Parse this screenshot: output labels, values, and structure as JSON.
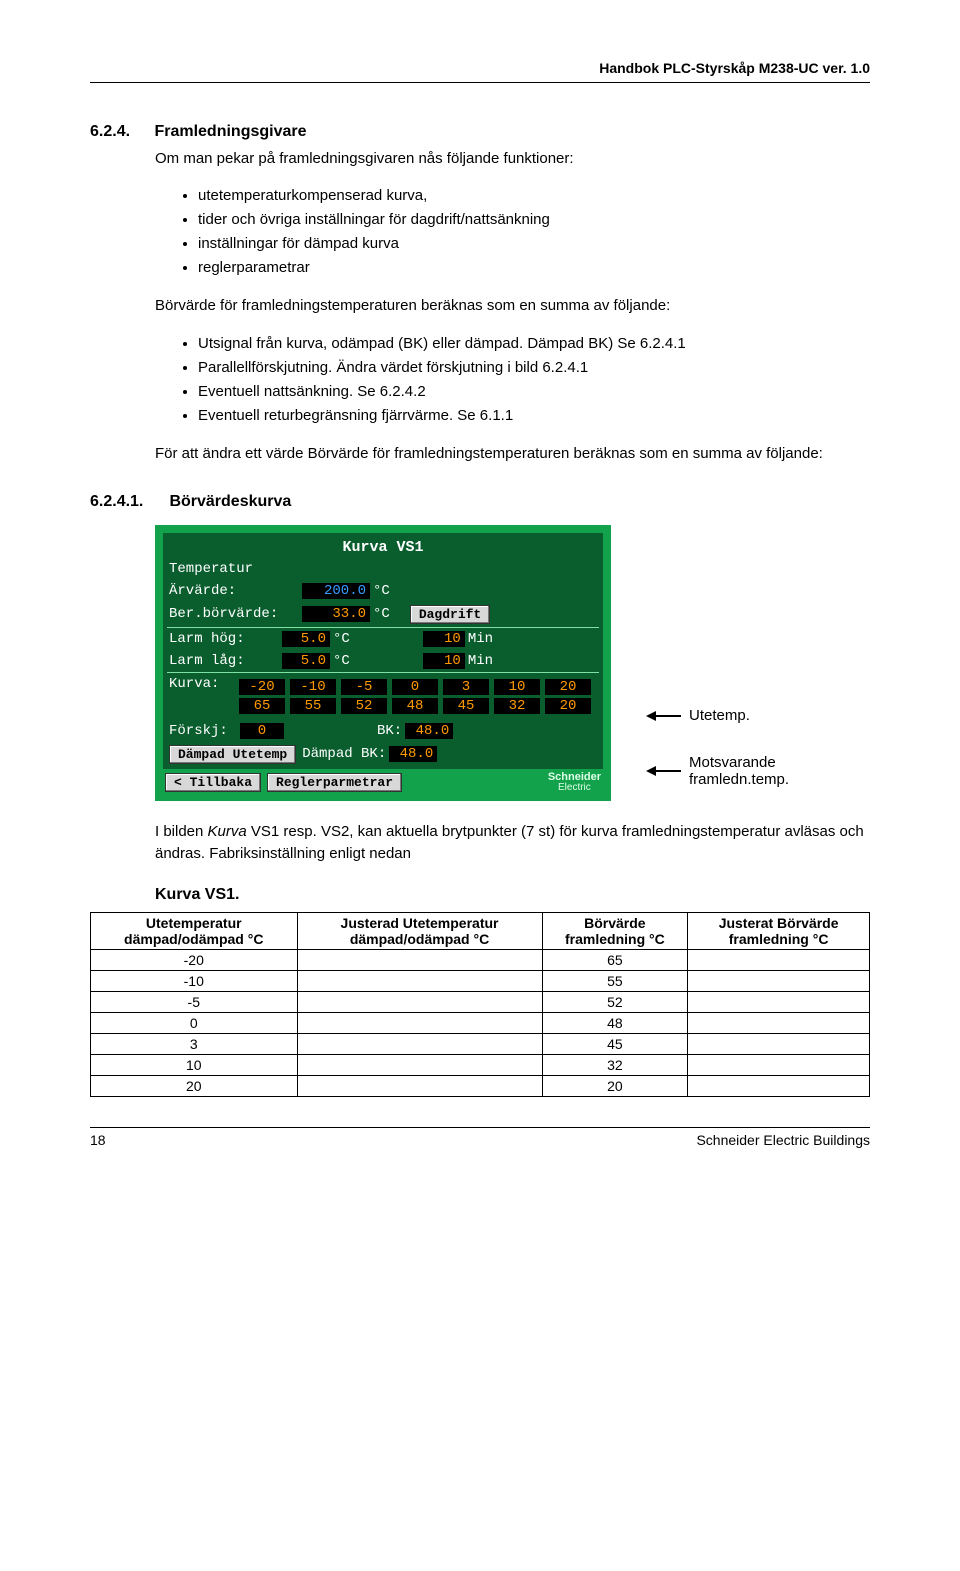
{
  "header": "Handbok PLC-Styrskåp M238-UC ver. 1.0",
  "section": {
    "num": "6.2.4.",
    "title": "Framledningsgivare",
    "intro": "Om man pekar på framledningsgivaren nås följande funktioner:",
    "bullets1": [
      "utetemperaturkompenserad kurva,",
      "tider och övriga inställningar för dagdrift/nattsänkning",
      "inställningar för dämpad kurva",
      "reglerparametrar"
    ],
    "para2": "Börvärde för framledningstemperaturen beräknas som en summa av följande:",
    "bullets2": [
      "Utsignal från kurva, odämpad (BK) eller dämpad. Dämpad BK) Se 6.2.4.1",
      "Parallellförskjutning. Ändra värdet förskjutning i bild 6.2.4.1",
      "Eventuell nattsänkning. Se 6.2.4.2",
      "Eventuell returbegränsning fjärrvärme. Se 6.1.1"
    ],
    "para3": "För att ändra ett värde Börvärde för framledningstemperaturen beräknas som en summa av följande:"
  },
  "subsection": {
    "num": "6.2.4.1.",
    "title": "Börvärdeskurva"
  },
  "plc": {
    "title": "Kurva VS1",
    "rows": {
      "temperature_label": "Temperatur",
      "arvarde_label": "Ärvärde:",
      "arvarde_val": "200.0",
      "arvarde_unit": "°C",
      "ber_label": "Ber.börvärde:",
      "ber_val": "33.0",
      "ber_unit": "°C",
      "dagdrift_btn": "Dagdrift",
      "larm_hog_label": "Larm hög:",
      "larm_hog_val": "5.0",
      "larm_hog_unit": "°C",
      "larm_hog_min_val": "10",
      "larm_hog_min_unit": "Min",
      "larm_lag_label": "Larm låg:",
      "larm_lag_val": "5.0",
      "larm_lag_unit": "°C",
      "larm_lag_min_val": "10",
      "larm_lag_min_unit": "Min",
      "kurva_label": "Kurva:",
      "kurva_row1": [
        "-20",
        "-10",
        "-5",
        "0",
        "3",
        "10",
        "20"
      ],
      "kurva_row2": [
        "65",
        "55",
        "52",
        "48",
        "45",
        "32",
        "20"
      ],
      "forskj_label": "Förskj:",
      "forskj_val": "0",
      "bk_label": "BK:",
      "bk_val": "48.0",
      "damp_ute_btn": "Dämpad Utetemp",
      "damp_bk_label": "Dämpad BK:",
      "damp_bk_val": "48.0",
      "back_btn": "< Tillbaka",
      "regler_btn": "Reglerparmetrar",
      "brand": "Schneider",
      "brand2": "Electric"
    }
  },
  "annotations": {
    "a1": "Utetemp.",
    "a2_line1": "Motsvarande",
    "a2_line2": "framledn.temp."
  },
  "after_plc": {
    "prefix": "I bilden ",
    "italic": "Kurva ",
    "rest": "VS1 resp. VS2, kan aktuella brytpunkter (7 st) för kurva framledningstemperatur avläsas och ändras. Fabriksinställning enligt nedan"
  },
  "kurva_heading": "Kurva VS1.",
  "table": {
    "headers": [
      "Utetemperatur dämpad/odämpad °C",
      "Justerad Utetemperatur dämpad/odämpad °C",
      "Börvärde framledning °C",
      "Justerat Börvärde framledning °C"
    ],
    "rows": [
      {
        "c1": "-20",
        "c2": "",
        "c3": "65",
        "c4": ""
      },
      {
        "c1": "-10",
        "c2": "",
        "c3": "55",
        "c4": ""
      },
      {
        "c1": "-5",
        "c2": "",
        "c3": "52",
        "c4": ""
      },
      {
        "c1": "0",
        "c2": "",
        "c3": "48",
        "c4": ""
      },
      {
        "c1": "3",
        "c2": "",
        "c3": "45",
        "c4": ""
      },
      {
        "c1": "10",
        "c2": "",
        "c3": "32",
        "c4": ""
      },
      {
        "c1": "20",
        "c2": "",
        "c3": "20",
        "c4": ""
      }
    ]
  },
  "footer": {
    "page": "18",
    "brand": "Schneider Electric Buildings"
  }
}
